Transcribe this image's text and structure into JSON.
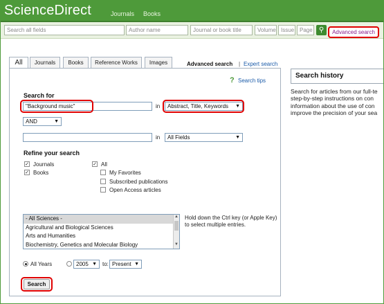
{
  "header": {
    "logo": "ScienceDirect",
    "nav": [
      "Journals",
      "Books"
    ]
  },
  "quick_search": {
    "all_fields_placeholder": "Search all fields",
    "author_placeholder": "Author name",
    "journal_placeholder": "Journal or book title",
    "volume_placeholder": "Volume",
    "issue_placeholder": "Issue",
    "page_placeholder": "Page",
    "advanced_link": "Advanced search"
  },
  "tabs": [
    "All",
    "Journals",
    "Books",
    "Reference Works",
    "Images"
  ],
  "panel": {
    "title": "Advanced search",
    "separator": "|",
    "expert_link": "Expert search",
    "tips_link": "Search tips",
    "search_for_label": "Search for",
    "term1_value": "\"Background music\"",
    "in_label": "in",
    "field1_value": "Abstract, Title, Keywords",
    "operator_value": "AND",
    "term2_value": "",
    "field2_value": "All Fields",
    "refine_label": "Refine your search",
    "checkboxes": {
      "journals": "Journals",
      "books": "Books",
      "all": "All",
      "favorites": "My Favorites",
      "subscribed": "Subscribed publications",
      "open_access": "Open Access articles"
    },
    "subjects": [
      "- All Sciences -",
      "Agricultural and Biological Sciences",
      "Arts and Humanities",
      "Biochemistry, Genetics and Molecular Biology"
    ],
    "subjects_hint": "Hold down the Ctrl key (or Apple Key) to select multiple entries.",
    "years": {
      "all_years": "All Years",
      "from_value": "2005",
      "to_label": "to:",
      "to_value": "Present"
    },
    "search_button": "Search"
  },
  "history": {
    "title": "Search history",
    "description_lines": [
      "Search for articles from our full-te",
      "step-by-step instructions on con",
      "information about the use of con",
      "improve the precision of your sea"
    ]
  },
  "colors": {
    "brand_green": "#4e9a3a",
    "highlight_red": "#e00000",
    "link_blue": "#1a5aa8"
  }
}
